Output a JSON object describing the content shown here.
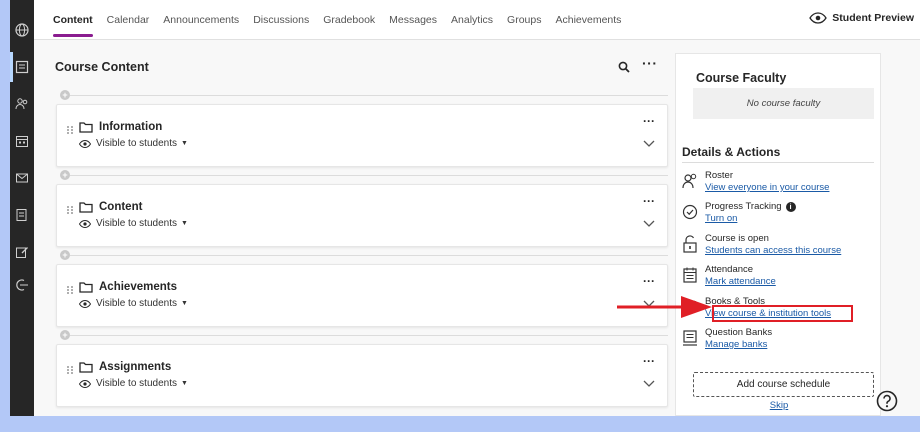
{
  "nav": {
    "tabs": [
      {
        "label": "Content",
        "active": true
      },
      {
        "label": "Calendar"
      },
      {
        "label": "Announcements"
      },
      {
        "label": "Discussions"
      },
      {
        "label": "Gradebook"
      },
      {
        "label": "Messages"
      },
      {
        "label": "Analytics"
      },
      {
        "label": "Groups"
      },
      {
        "label": "Achievements"
      }
    ],
    "student_preview": "Student Preview"
  },
  "rail": {
    "icons": [
      "globe-icon",
      "course-icon",
      "people-icon",
      "calendar-icon",
      "mail-icon",
      "grades-icon",
      "edit-icon",
      "signout-icon"
    ]
  },
  "content": {
    "title": "Course Content",
    "items": [
      {
        "name": "Information",
        "visibility": "Visible to students"
      },
      {
        "name": "Content",
        "visibility": "Visible to students"
      },
      {
        "name": "Achievements",
        "visibility": "Visible to students"
      },
      {
        "name": "Assignments",
        "visibility": "Visible to students"
      }
    ]
  },
  "panel": {
    "faculty_title": "Course Faculty",
    "faculty_empty": "No course faculty",
    "details_title": "Details & Actions",
    "actions": [
      {
        "label": "Roster",
        "link": "View everyone in your course",
        "icon": "roster-icon"
      },
      {
        "label": "Progress Tracking",
        "link": "Turn on",
        "icon": "progress-icon",
        "info": "i"
      },
      {
        "label": "Course is open",
        "link": "Students can access this course",
        "icon": "lock-open-icon"
      },
      {
        "label": "Attendance",
        "link": "Mark attendance",
        "icon": "attendance-icon"
      },
      {
        "label": "Books & Tools",
        "link": "View course & institution tools",
        "icon": "wrench-icon"
      },
      {
        "label": "Question Banks",
        "link": "Manage banks",
        "icon": "question-bank-icon"
      }
    ],
    "schedule_button": "Add course schedule",
    "skip": "Skip"
  },
  "colors": {
    "accent": "#8a1c8f",
    "link": "#1a5aa6",
    "highlight": "#e01f26",
    "background": "#b3c8f7"
  }
}
